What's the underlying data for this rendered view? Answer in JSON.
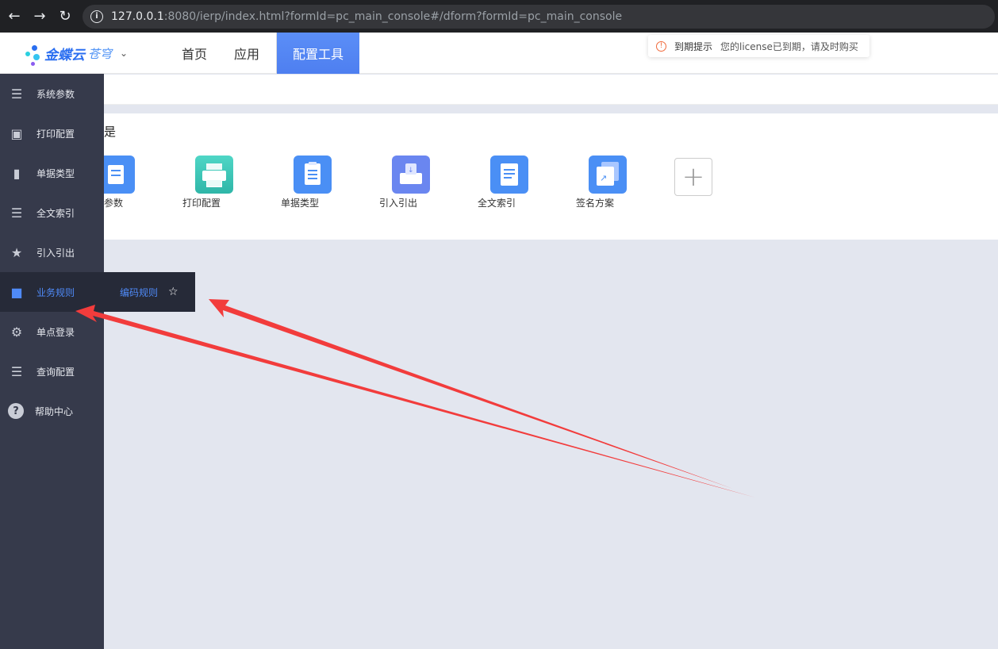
{
  "browser": {
    "url_host": "127.0.0.1",
    "url_rest": ":8080/ierp/index.html?formId=pc_main_console#/dform?formId=pc_main_console",
    "back_icon": "arrow-left-icon",
    "forward_icon": "arrow-right-icon",
    "reload_icon": "reload-icon"
  },
  "header": {
    "logo_text": "金蝶云",
    "logo_sub": "苍穹",
    "nav": [
      "首页",
      "应用",
      "配置工具"
    ],
    "active_nav": "配置工具"
  },
  "notice": {
    "title": "到期提示",
    "message": "您的license已到期，请及时购买"
  },
  "card": {
    "title": "是",
    "tiles": [
      {
        "label": "参数",
        "color": "#4a8ff5"
      },
      {
        "label": "打印配置",
        "color": "#3cc6b8"
      },
      {
        "label": "单据类型",
        "color": "#4a8ff5"
      },
      {
        "label": "引入引出",
        "color": "#6a86f0"
      },
      {
        "label": "全文索引",
        "color": "#4a8ff5"
      },
      {
        "label": "签名方案",
        "color": "#4a8ff5"
      }
    ]
  },
  "sidebar": {
    "items": [
      {
        "label": "系统参数",
        "icon": "layers-icon"
      },
      {
        "label": "打印配置",
        "icon": "picture-icon"
      },
      {
        "label": "单据类型",
        "icon": "folder-icon"
      },
      {
        "label": "全文索引",
        "icon": "layers-icon"
      },
      {
        "label": "引入引出",
        "icon": "book-star-icon"
      },
      {
        "label": "业务规则",
        "icon": "book-icon"
      },
      {
        "label": "单点登录",
        "icon": "login-icon"
      },
      {
        "label": "查询配置",
        "icon": "layers-icon"
      },
      {
        "label": "帮助中心",
        "icon": "help-icon"
      }
    ],
    "active_index": 5
  },
  "flyout": {
    "label": "编码规则",
    "star_icon": "star-icon"
  },
  "colors": {
    "accent": "#4f8af7",
    "sidebar_bg": "#363a4b",
    "arrow": "#f23c3c"
  }
}
